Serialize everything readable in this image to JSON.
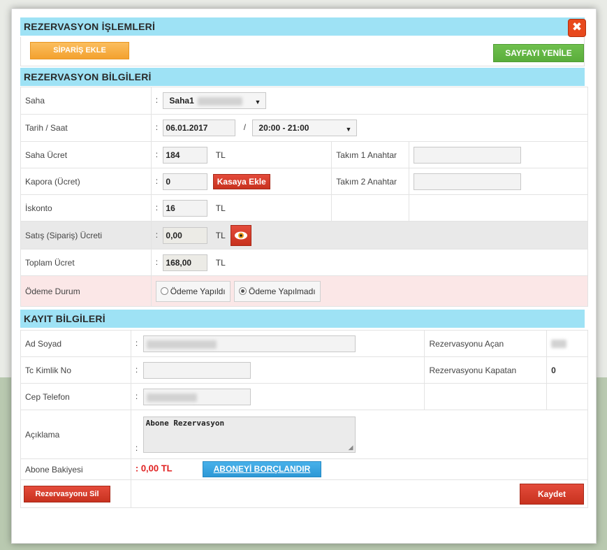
{
  "modal": {
    "title": "REZERVASYON İŞLEMLERİ",
    "close_symbol": "✖",
    "close_icon": "close-icon"
  },
  "toolbar": {
    "add_order_label": "SİPARİŞ EKLE",
    "refresh_label": "SAYFAYI YENİLE"
  },
  "reservation": {
    "section_title": "REZERVASYON BİLGİLERİ",
    "sep": ":",
    "field_label": "Saha",
    "field_value": "Saha1",
    "datetime_label": "Tarih / Saat",
    "date_value": "06.01.2017",
    "slash": "/",
    "time_value": "20:00 - 21:00",
    "fee_label": "Saha Ücret",
    "fee_value": "184",
    "currency": "TL",
    "team1_key_label": "Takım 1 Anahtar",
    "team1_key_value": "",
    "deposit_label": "Kapora (Ücret)",
    "deposit_value": "0",
    "add_to_cash_label": "Kasaya Ekle",
    "team2_key_label": "Takım 2 Anahtar",
    "team2_key_value": "",
    "discount_label": "İskonto",
    "discount_value": "16",
    "sales_fee_label": "Satış (Sipariş) Ücreti",
    "sales_fee_value": "0,00",
    "eye_icon": "eye-icon",
    "total_label": "Toplam Ücret",
    "total_value": "168,00",
    "payment_label": "Ödeme Durum",
    "payment_options": [
      "Ödeme Yapıldı",
      "Ödeme Yapılmadı"
    ],
    "payment_selected": "Ödeme Yapılmadı"
  },
  "record": {
    "section_title": "KAYIT BİLGİLERİ",
    "name_label": "Ad Soyad",
    "name_value": "",
    "opened_by_label": "Rezervasyonu Açan",
    "opened_by_value": "",
    "tc_label": "Tc Kimlik No",
    "tc_value": "",
    "closed_by_label": "Rezervasyonu Kapatan",
    "closed_by_value": "0",
    "phone_label": "Cep Telefon",
    "phone_value": "",
    "note_label": "Açıklama",
    "note_value": "Abone Rezervasyon",
    "balance_label": "Abone Bakiyesi",
    "balance_value": ": 0,00 TL",
    "charge_label": "ABONEYİ BORÇLANDIR",
    "delete_label": "Rezervasyonu Sil",
    "save_label": "Kaydet"
  },
  "colors": {
    "section_bar": "#9ee2f5",
    "orange_button": "#f3a12f",
    "green_button": "#5aad3b",
    "red_button": "#c8321f",
    "blue_button": "#2d98d6",
    "balance_text": "#e02020"
  }
}
